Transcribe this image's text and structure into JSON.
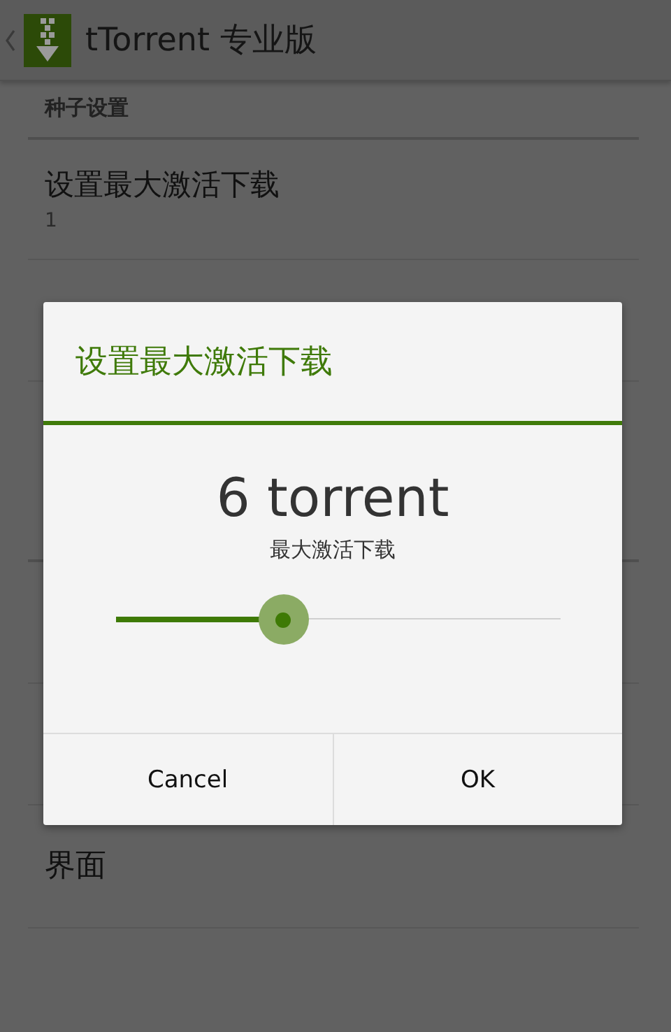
{
  "action_bar": {
    "title": "tTorrent 专业版"
  },
  "settings": {
    "section": "种子设置",
    "rows": [
      {
        "title": "设置最大激活下载",
        "value": "1"
      }
    ],
    "section_2": "界面"
  },
  "dialog": {
    "title": "设置最大激活下载",
    "value": "6 torrent",
    "subtitle": "最大激活下载",
    "slider": {
      "level": 0.377
    },
    "buttons": [
      "Cancel",
      "OK"
    ]
  }
}
